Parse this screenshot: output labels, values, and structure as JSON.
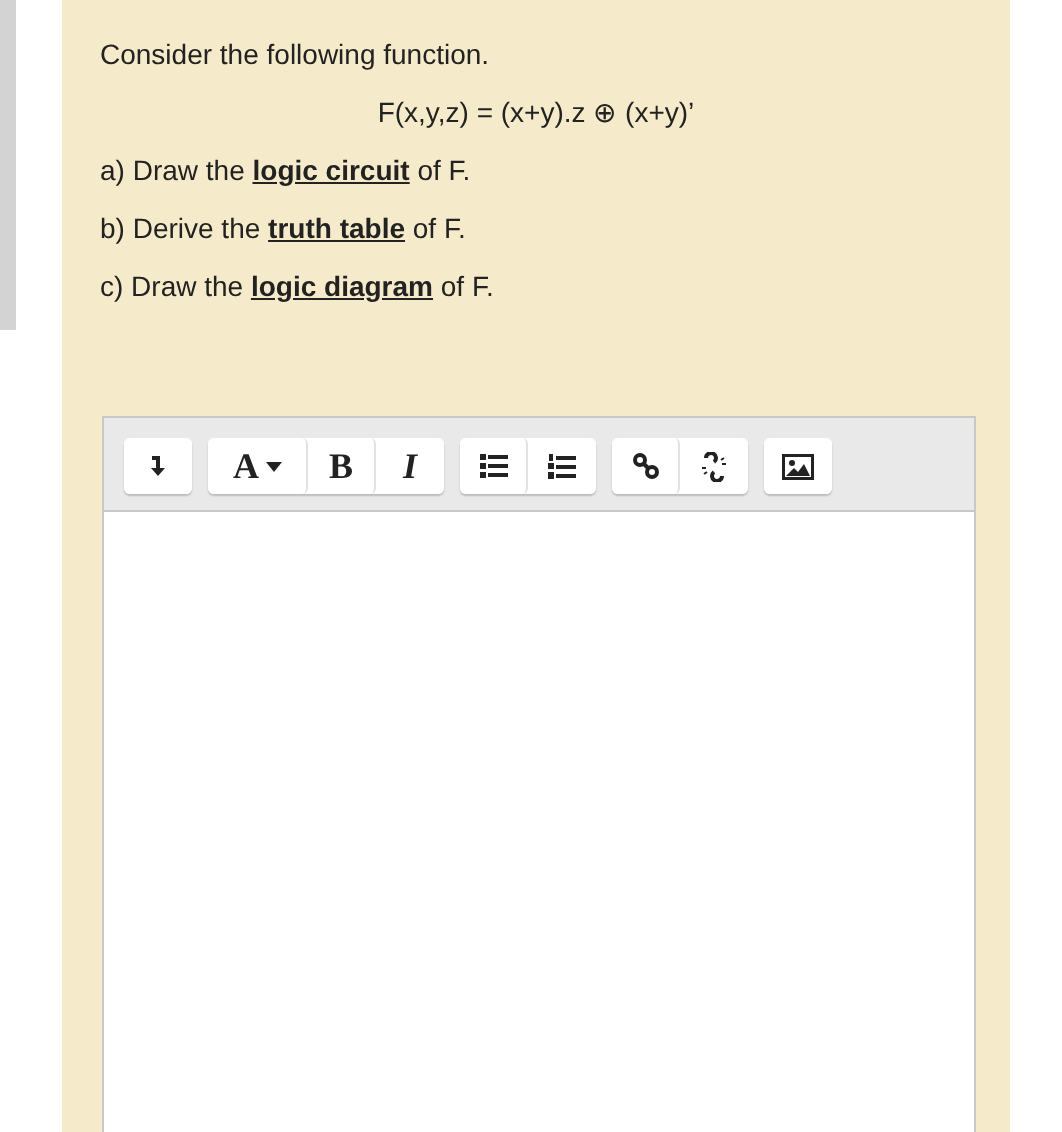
{
  "question": {
    "intro": "Consider the following function.",
    "formula": "F(x,y,z) = (x+y).z ⊕  (x+y)’",
    "parts": [
      "a) Draw the **logic circuit** of F.",
      "b) Derive the **truth table** of F.",
      "c) Draw the **logic diagram** of F."
    ]
  },
  "editor": {
    "toolbar": [
      [
        {
          "kind": "collapse"
        }
      ],
      [
        {
          "kind": "font",
          "label": "A"
        },
        {
          "kind": "bold",
          "label": "B"
        },
        {
          "kind": "italic",
          "label": "I"
        }
      ],
      [
        {
          "kind": "bullets"
        },
        {
          "kind": "numbers"
        }
      ],
      [
        {
          "kind": "link"
        },
        {
          "kind": "unlink"
        }
      ],
      [
        {
          "kind": "image"
        }
      ]
    ]
  }
}
